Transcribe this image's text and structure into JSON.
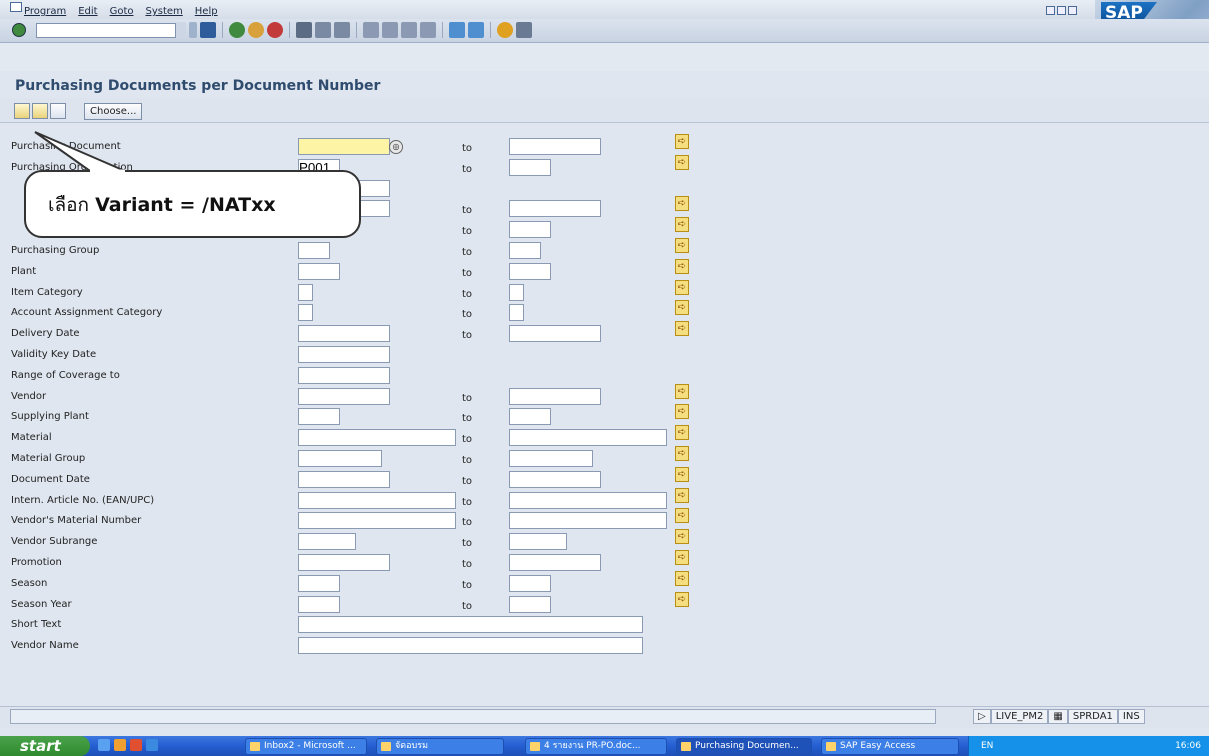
{
  "menu": {
    "items": [
      "Program",
      "Edit",
      "Goto",
      "System",
      "Help"
    ]
  },
  "toolbar": {
    "command_value": ""
  },
  "screen": {
    "title": "Purchasing Documents per Document Number"
  },
  "app_toolbar": {
    "choose_label": "Choose..."
  },
  "callout": {
    "prefix": "เลือก ",
    "bold": "Variant = /NATxx"
  },
  "fields": [
    {
      "label": "Purchasing Document",
      "value": "",
      "to": "to",
      "multi": true
    },
    {
      "label": "Purchasing Organization",
      "value": "P001",
      "to": "to",
      "multi": true
    },
    {
      "label": "",
      "value": "",
      "to": "",
      "multi": false
    },
    {
      "label": "",
      "value": "",
      "to": "to",
      "multi": true
    },
    {
      "label": "",
      "value": "",
      "to": "to",
      "multi": true
    },
    {
      "label": "Purchasing Group",
      "value": "",
      "to": "to",
      "multi": true
    },
    {
      "label": "Plant",
      "value": "",
      "to": "to",
      "multi": true
    },
    {
      "label": "Item Category",
      "value": "",
      "to": "to",
      "multi": true
    },
    {
      "label": "Account Assignment Category",
      "value": "",
      "to": "to",
      "multi": true
    },
    {
      "label": "Delivery Date",
      "value": "",
      "to": "to",
      "multi": true
    },
    {
      "label": "Validity Key Date",
      "value": "",
      "to": "",
      "multi": false
    },
    {
      "label": "Range of Coverage to",
      "value": "",
      "to": "",
      "multi": false
    },
    {
      "label": "Vendor",
      "value": "",
      "to": "to",
      "multi": true
    },
    {
      "label": "Supplying Plant",
      "value": "",
      "to": "to",
      "multi": true
    },
    {
      "label": "Material",
      "value": "",
      "to": "to",
      "multi": true
    },
    {
      "label": "Material Group",
      "value": "",
      "to": "to",
      "multi": true
    },
    {
      "label": "Document Date",
      "value": "",
      "to": "to",
      "multi": true
    },
    {
      "label": "Intern. Article No. (EAN/UPC)",
      "value": "",
      "to": "to",
      "multi": true
    },
    {
      "label": "Vendor's Material Number",
      "value": "",
      "to": "to",
      "multi": true
    },
    {
      "label": "Vendor Subrange",
      "value": "",
      "to": "to",
      "multi": true
    },
    {
      "label": "Promotion",
      "value": "",
      "to": "to",
      "multi": true
    },
    {
      "label": "Season",
      "value": "",
      "to": "to",
      "multi": true
    },
    {
      "label": "Season Year",
      "value": "",
      "to": "to",
      "multi": true
    },
    {
      "label": "Short Text",
      "value": "",
      "to": "",
      "multi": false
    },
    {
      "label": "Vendor Name",
      "value": "",
      "to": "",
      "multi": false
    }
  ],
  "status": {
    "system": "LIVE_PM2",
    "client": "SPRDA1",
    "mode": "INS"
  },
  "taskbar": {
    "start": "start",
    "tasks": [
      "Inbox2 - Microsoft ...",
      "จัดอบรม",
      "4 รายงาน PR-PO.doc...",
      "Purchasing Documen...",
      "SAP Easy Access"
    ],
    "lang": "EN",
    "time": "16:06"
  }
}
